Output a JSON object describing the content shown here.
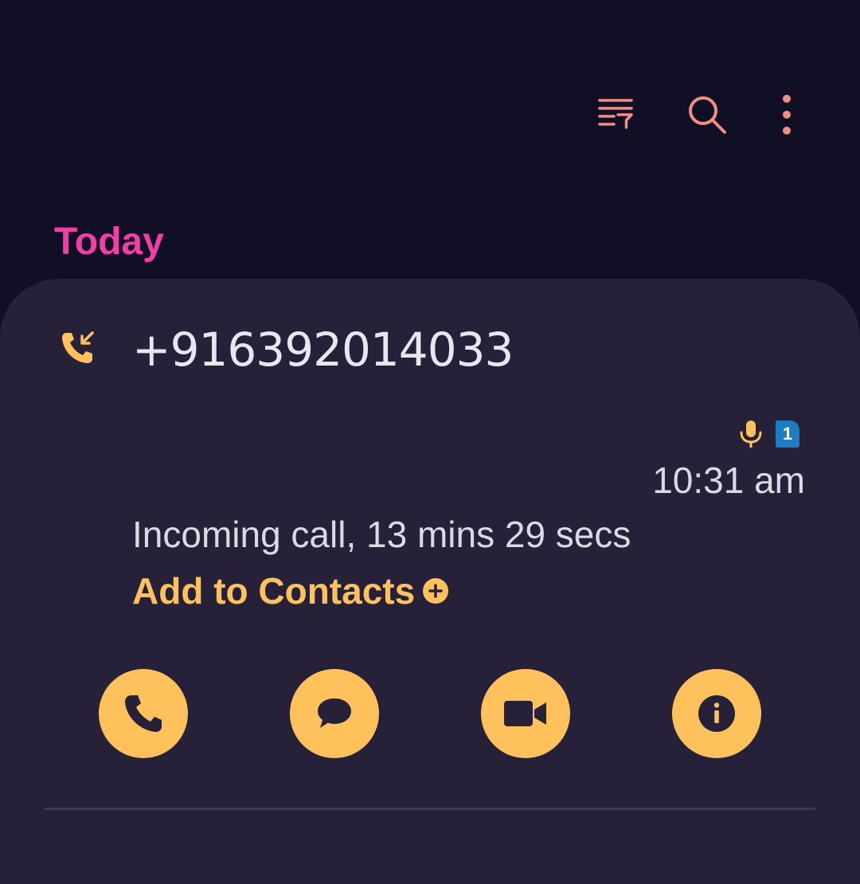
{
  "toolbar": {
    "filter_icon": "filter-list-icon",
    "search_icon": "search-icon",
    "more_icon": "more-vertical-icon"
  },
  "section": {
    "title": "Today"
  },
  "call_log": {
    "entries": [
      {
        "call_type_icon": "incoming-call-icon",
        "number": "+916392014033",
        "recording_icon": "microphone-icon",
        "sim_label": "1",
        "time": "10:31 am",
        "detail": "Incoming call, 13 mins 29 secs",
        "add_contact_label": "Add to Contacts",
        "add_contact_icon": "plus-circle-icon",
        "actions": [
          {
            "icon": "phone-icon"
          },
          {
            "icon": "message-icon"
          },
          {
            "icon": "video-call-icon"
          },
          {
            "icon": "info-icon"
          }
        ]
      }
    ]
  },
  "colors": {
    "background": "#100f25",
    "card": "#262038",
    "section_title": "#f23fa8",
    "accent": "#ffc15c",
    "toolbar_icons": "#f08e80",
    "sim_badge": "#1e7cc0",
    "primary_text": "#e9e6ef",
    "divider": "#3f3a52"
  }
}
